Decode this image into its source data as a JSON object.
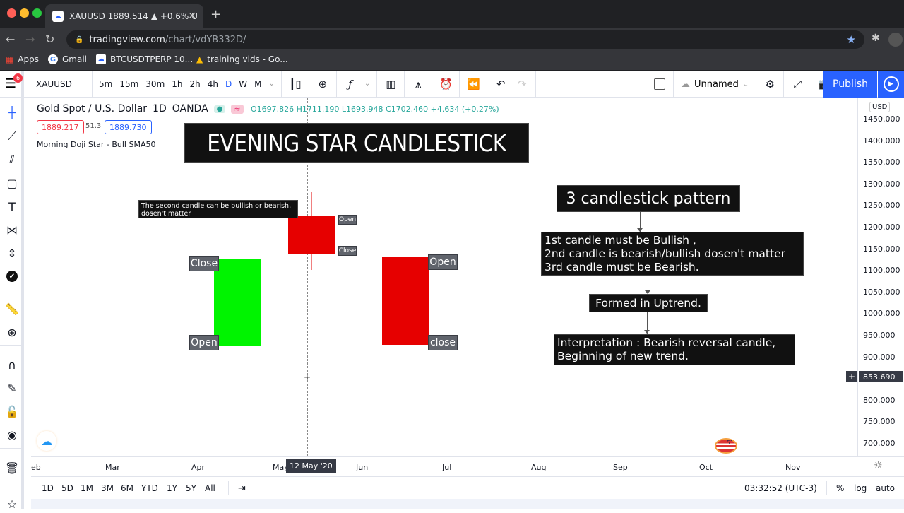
{
  "browser": {
    "tab_title": "XAUUSD 1889.514 ▲ +0.6% U",
    "url_host": "tradingview.com",
    "url_path": "/chart/vdYB332D/",
    "bookmarks": [
      "Apps",
      "Gmail",
      "BTCUSDTPERP 10...",
      "training vids - Go..."
    ]
  },
  "toolbar": {
    "symbol": "XAUUSD",
    "intervals": [
      "5m",
      "15m",
      "30m",
      "1h",
      "2h",
      "4h",
      "D",
      "W",
      "M"
    ],
    "active_interval": "D",
    "layout_name": "Unnamed",
    "publish_label": "Publish",
    "menu_badge": "6"
  },
  "legend": {
    "title": "Gold Spot / U.S. Dollar",
    "interval": "1D",
    "exchange": "OANDA",
    "ohlc": "O1697.826 H1711.190 L1693.948 C1702.460 +4.634 (+0.27%)",
    "bid": "1889.217",
    "spread": "51.3",
    "ask": "1889.730",
    "indicator": "Morning Doji Star - Bull SMA50"
  },
  "annotations": {
    "title": "EVENING STAR CANDLESTICK",
    "second_candle_note_line1": "The second candle can be bullish or bearish,",
    "second_candle_note_line2": "dosen't matter",
    "pattern_title": "3 candlestick pattern",
    "rules_line1": "1st candle must be  Bullish ,",
    "rules_line2": "2nd candle is bearish/bullish dosen't matter",
    "rules_line3": "3rd candle must be Bearish.",
    "trend": "Formed in Uptrend.",
    "interpretation_line1": "Interpretation : Bearish reversal candle,",
    "interpretation_line2": "Beginning of new trend.",
    "c1_close": "Close",
    "c1_open": "Open",
    "c2_open": "Open",
    "c2_close": "Close",
    "c3_open": "Open",
    "c3_close": "close"
  },
  "price_axis": {
    "currency": "USD",
    "ticks": [
      "1450.000",
      "1400.000",
      "1350.000",
      "1300.000",
      "1250.000",
      "1200.000",
      "1150.000",
      "1100.000",
      "1050.000",
      "1000.000",
      "950.000",
      "900.000",
      "800.000",
      "750.000",
      "700.000"
    ],
    "crosshair_price": "853.690"
  },
  "time_axis": {
    "ticks": [
      "eb",
      "Mar",
      "Apr",
      "May",
      "Jun",
      "Jul",
      "Aug",
      "Sep",
      "Oct",
      "Nov"
    ],
    "crosshair_date": "12 May '20"
  },
  "bottom": {
    "ranges": [
      "1D",
      "5D",
      "1M",
      "3M",
      "6M",
      "YTD",
      "1Y",
      "5Y",
      "All"
    ],
    "clock": "03:32:52 (UTC-3)",
    "percent": "%",
    "log": "log",
    "auto": "auto"
  }
}
